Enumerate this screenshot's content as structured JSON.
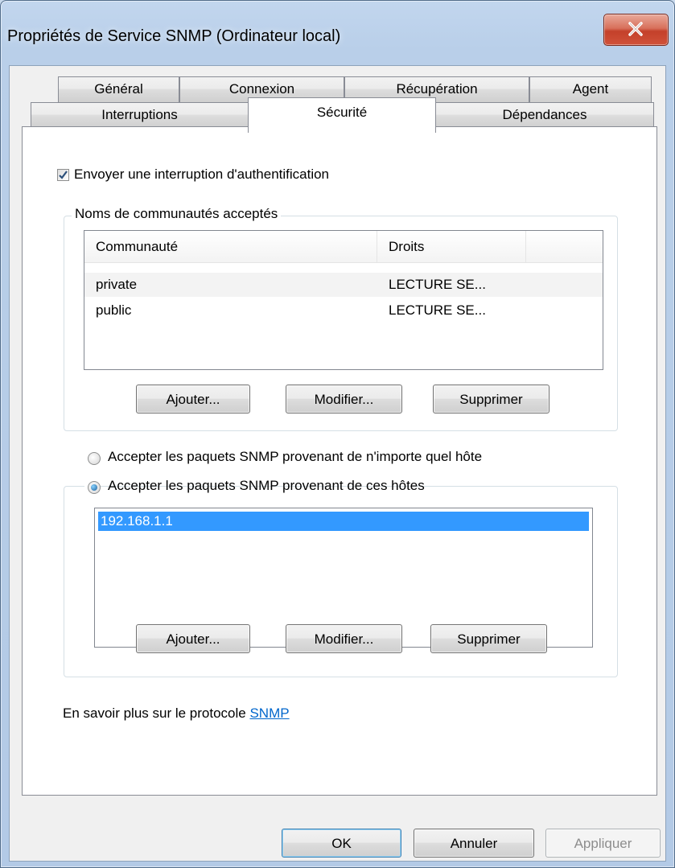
{
  "window": {
    "title": "Propriétés de Service SNMP (Ordinateur local)"
  },
  "tabs": {
    "row1": [
      {
        "label": "Général"
      },
      {
        "label": "Connexion"
      },
      {
        "label": "Récupération"
      },
      {
        "label": "Agent"
      }
    ],
    "row2": [
      {
        "label": "Interruptions"
      },
      {
        "label": "Sécurité",
        "active": true
      },
      {
        "label": "Dépendances"
      }
    ]
  },
  "security": {
    "send_auth_trap": {
      "label": "Envoyer une interruption d'authentification",
      "checked": true
    },
    "communities": {
      "legend": "Noms de communautés acceptés",
      "columns": [
        "Communauté",
        "Droits"
      ],
      "rows": [
        {
          "name": "private",
          "rights": "LECTURE SE..."
        },
        {
          "name": "public",
          "rights": "LECTURE SE..."
        }
      ],
      "buttons": {
        "add": "Ajouter...",
        "edit": "Modifier...",
        "remove": "Supprimer"
      }
    },
    "accept_any": {
      "label": "Accepter les paquets SNMP provenant de n'importe quel hôte",
      "checked": false
    },
    "accept_hosts": {
      "label": "Accepter les paquets SNMP provenant de ces hôtes",
      "checked": true,
      "hosts": [
        "192.168.1.1"
      ],
      "buttons": {
        "add": "Ajouter...",
        "edit": "Modifier...",
        "remove": "Supprimer"
      }
    },
    "learn_more": {
      "text": "En savoir plus sur le protocole",
      "link": "SNMP"
    }
  },
  "footer": {
    "ok": "OK",
    "cancel": "Annuler",
    "apply": "Appliquer"
  },
  "colors": {
    "selection": "#3399ff",
    "link": "#0066cc"
  },
  "icons": {
    "close": "close-icon",
    "check": "checkmark-icon"
  }
}
